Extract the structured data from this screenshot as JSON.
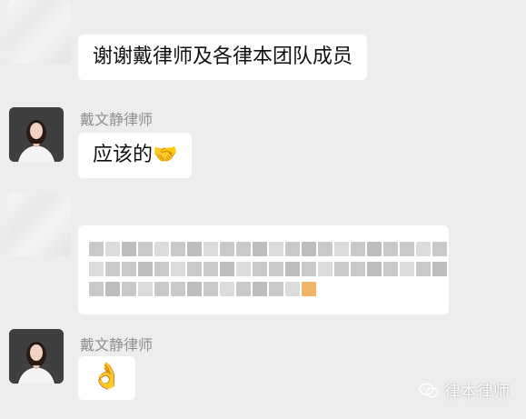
{
  "messages": [
    {
      "sender_redacted": true,
      "text": "谢谢戴律师及各律本团队成员"
    },
    {
      "sender_name": "戴文静律师",
      "text": "应该的🤝"
    },
    {
      "sender_redacted": true,
      "text_blurred": true
    },
    {
      "sender_name": "戴文静律师",
      "emoji": "👌"
    }
  ],
  "watermark": {
    "text": "律本律师",
    "icon": "wechat-icon"
  },
  "colors": {
    "background": "#ededed",
    "bubble": "#ffffff",
    "name": "#8e8e8e",
    "text": "#111111"
  }
}
